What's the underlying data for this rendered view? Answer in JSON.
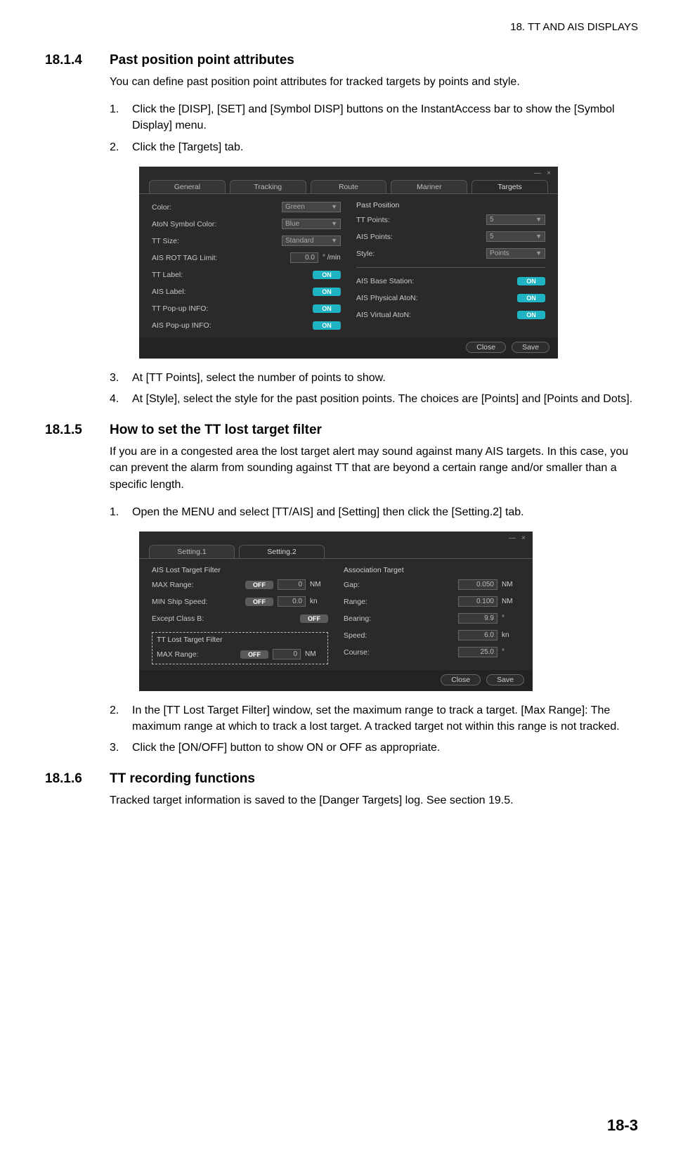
{
  "header": "18.  TT AND AIS DISPLAYS",
  "s1": {
    "num": "18.1.4",
    "title": "Past position point attributes",
    "intro": "You can define past position point attributes for tracked targets by points and style.",
    "li1": "Click the [DISP], [SET] and [Symbol DISP] buttons on the InstantAccess bar to show the [Symbol Display] menu.",
    "li2": "Click the [Targets] tab.",
    "li3": "At [TT Points], select the number of points to show.",
    "li4": "At [Style], select the style for the past position points. The choices are [Points] and [Points and Dots]."
  },
  "dlg1": {
    "tabs": {
      "general": "General",
      "tracking": "Tracking",
      "route": "Route",
      "mariner": "Mariner",
      "targets": "Targets"
    },
    "left": {
      "color": "Color:",
      "color_v": "Green",
      "aton": "AtoN Symbol Color:",
      "aton_v": "Blue",
      "ttsize": "TT Size:",
      "ttsize_v": "Standard",
      "ais_rot": "AIS ROT TAG Limit:",
      "ais_rot_v": "0.0",
      "ais_rot_u": "° /min",
      "ttlabel": "TT Label:",
      "aislabel": "AIS Label:",
      "ttpop": "TT Pop-up INFO:",
      "aispop": "AIS Pop-up INFO:"
    },
    "right": {
      "past": "Past Position",
      "ttpts": "TT Points:",
      "ttpts_v": "5",
      "aispts": "AIS Points:",
      "aispts_v": "5",
      "style": "Style:",
      "style_v": "Points",
      "base": "AIS Base Station:",
      "phys": "AIS Physical AtoN:",
      "virt": "AIS Virtual AtoN:"
    },
    "on": "ON",
    "close": "Close",
    "save": "Save"
  },
  "s2": {
    "num": "18.1.5",
    "title": "How to set the TT lost target filter",
    "intro": "If you are in a congested area the lost target alert may sound against many AIS targets. In this case, you can prevent the alarm from sounding against TT that are beyond a certain range and/or smaller than a specific length.",
    "li1": "Open the MENU and select [TT/AIS] and [Setting] then click the [Setting.2] tab.",
    "li2": "In the [TT Lost Target Filter] window, set the maximum range to track a target. [Max Range]: The maximum range at which to track a lost target. A tracked target not within this range is not tracked.",
    "li3": "Click the [ON/OFF] button to show ON or OFF as appropriate."
  },
  "dlg2": {
    "tabs": {
      "s1": "Setting.1",
      "s2": "Setting.2"
    },
    "left": {
      "ais_h": "AIS Lost Target Filter",
      "maxr": "MAX Range:",
      "maxr_v": "0",
      "maxr_u": "NM",
      "mins": "MIN Ship Speed:",
      "mins_v": "0.0",
      "mins_u": "kn",
      "exc": "Except Class B:",
      "tt_h": "TT Lost Target Filter",
      "tt_maxr": "MAX Range:",
      "tt_maxr_v": "0",
      "tt_maxr_u": "NM"
    },
    "right": {
      "assoc": "Association Target",
      "gap": "Gap:",
      "gap_v": "0.050",
      "gap_u": "NM",
      "range": "Range:",
      "range_v": "0.100",
      "range_u": "NM",
      "bearing": "Bearing:",
      "bearing_v": "9.9",
      "bearing_u": "°",
      "speed": "Speed:",
      "speed_v": "6.0",
      "speed_u": "kn",
      "course": "Course:",
      "course_v": "25.0",
      "course_u": "°"
    },
    "off": "OFF",
    "close": "Close",
    "save": "Save"
  },
  "s3": {
    "num": "18.1.6",
    "title": "TT recording functions",
    "body": "Tracked target information is saved to the [Danger Targets] log. See section 19.5."
  },
  "page_num": "18-3"
}
